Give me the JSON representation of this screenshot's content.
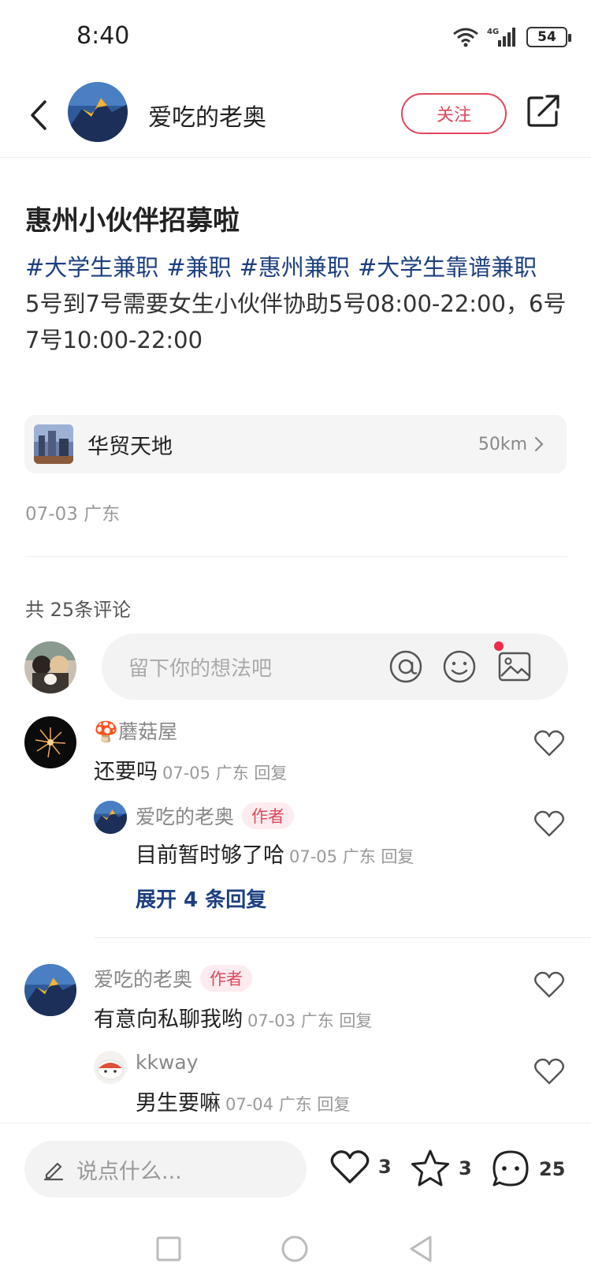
{
  "status_bar": {
    "time": "8:40",
    "network": "4G",
    "battery": "54"
  },
  "header": {
    "author_name": "爱吃的老奥",
    "follow_label": "关注"
  },
  "post": {
    "title": "惠州小伙伴招募啦",
    "hashtags": [
      "#大学生兼职",
      "#兼职",
      "#惠州兼职",
      "#大学生靠谱兼职"
    ],
    "content": "5号到7号需要女生小伙伴协助5号08:00-22:00，6号7号10:00-22:00",
    "location": {
      "name": "华贸天地",
      "distance": "50km"
    },
    "meta": "07-03 广东"
  },
  "comments_section": {
    "count_label": "共 25条评论",
    "input_placeholder": "留下你的想法吧",
    "comments": [
      {
        "user": "🍄蘑菇屋",
        "text": "还要吗",
        "meta": "07-05 广东 回复",
        "replies": [
          {
            "user": "爱吃的老奥",
            "tag": "作者",
            "text": "目前暂时够了哈",
            "meta": "07-05 广东 回复"
          }
        ],
        "expand_label": "展开 4 条回复"
      },
      {
        "user": "爱吃的老奥",
        "tag": "作者",
        "text": "有意向私聊我哟",
        "meta": "07-03 广东 回复",
        "replies": [
          {
            "user": "kkway",
            "text": "男生要嘛",
            "meta": "07-04 广东 回复"
          }
        ]
      }
    ]
  },
  "bottom_bar": {
    "placeholder": "说点什么...",
    "likes": "3",
    "collects": "3",
    "comments": "25"
  },
  "colors": {
    "accent": "#e0475c",
    "link": "#1d3f80"
  },
  "icons": [
    "back-icon",
    "share-icon",
    "at-icon",
    "emoji-icon",
    "image-icon",
    "heart-icon",
    "star-icon",
    "comment-icon",
    "pen-icon",
    "chevron-right-icon"
  ]
}
